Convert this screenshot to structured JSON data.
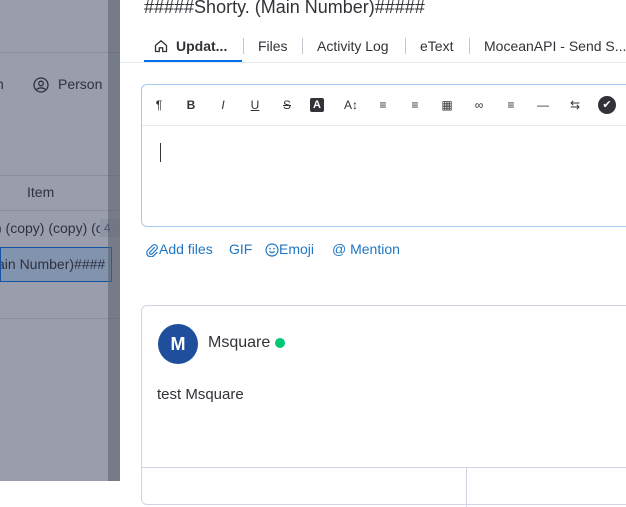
{
  "background": {
    "left_fragment": "n",
    "person_label": "Person",
    "item_header": "Item",
    "row1_text": ") (copy) (copy) (copy)",
    "row1_badge": "4",
    "row2_text": "ain Number)####"
  },
  "panel": {
    "title": "#####Shorty. (Main Number)#####",
    "tabs": [
      {
        "label": "Updat..."
      },
      {
        "label": "Files"
      },
      {
        "label": "Activity Log"
      },
      {
        "label": "eText"
      },
      {
        "label": "MoceanAPI - Send S..."
      }
    ]
  },
  "editor": {
    "toolbar": [
      {
        "icon": "paragraph-icon",
        "glyph": "¶"
      },
      {
        "icon": "bold-icon",
        "glyph": "B"
      },
      {
        "icon": "italic-icon",
        "glyph": "I"
      },
      {
        "icon": "underline-icon",
        "glyph": "U"
      },
      {
        "icon": "strikethrough-icon",
        "glyph": "S"
      },
      {
        "icon": "text-color-icon",
        "glyph": "A"
      },
      {
        "icon": "font-size-icon",
        "glyph": "A↕"
      },
      {
        "icon": "numbered-list-icon",
        "glyph": "≡"
      },
      {
        "icon": "bullet-list-icon",
        "glyph": "≡"
      },
      {
        "icon": "table-icon",
        "glyph": "▦"
      },
      {
        "icon": "link-icon",
        "glyph": "∞"
      },
      {
        "icon": "align-icon",
        "glyph": "≡"
      },
      {
        "icon": "divider-icon",
        "glyph": "—"
      },
      {
        "icon": "direction-icon",
        "glyph": "⇆"
      },
      {
        "icon": "checklist-icon",
        "glyph": "✔"
      }
    ]
  },
  "actions": {
    "add_files": "Add files",
    "gif": "GIF",
    "emoji": "Emoji",
    "mention": "Mention"
  },
  "update": {
    "avatar_letter": "M",
    "author": "Msquare",
    "body": "test Msquare"
  },
  "colors": {
    "accent": "#0073ea",
    "link": "#1f76c2",
    "online": "#00c875",
    "avatar": "#1f4e9c"
  }
}
